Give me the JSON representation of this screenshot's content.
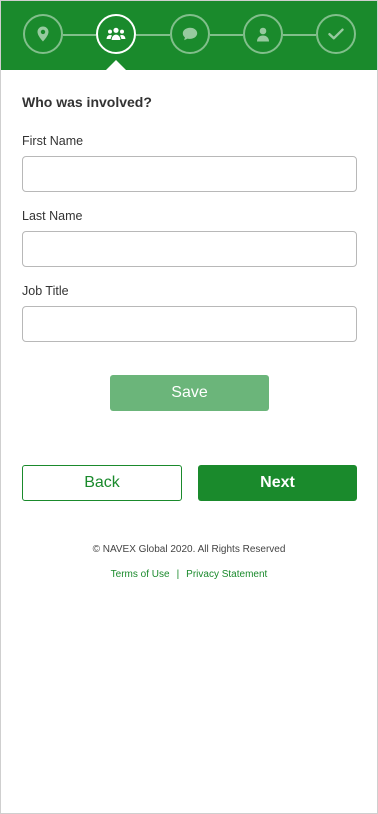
{
  "colors": {
    "brand_green": "#1a8a2c",
    "save_green_disabled": "#6bb57a",
    "step_inactive": "rgba(255,255,255,0.45)"
  },
  "stepper": {
    "steps": [
      {
        "icon": "location-pin-icon",
        "active": false
      },
      {
        "icon": "people-icon",
        "active": true
      },
      {
        "icon": "speech-bubble-icon",
        "active": false
      },
      {
        "icon": "person-icon",
        "active": false
      },
      {
        "icon": "checkmark-icon",
        "active": false
      }
    ]
  },
  "form": {
    "heading": "Who was involved?",
    "first_name_label": "First Name",
    "first_name_value": "",
    "last_name_label": "Last Name",
    "last_name_value": "",
    "job_title_label": "Job Title",
    "job_title_value": "",
    "save_label": "Save"
  },
  "nav": {
    "back_label": "Back",
    "next_label": "Next"
  },
  "footer": {
    "copyright": "© NAVEX Global 2020. All Rights Reserved",
    "terms_label": "Terms of Use",
    "separator": "|",
    "privacy_label": "Privacy Statement"
  }
}
